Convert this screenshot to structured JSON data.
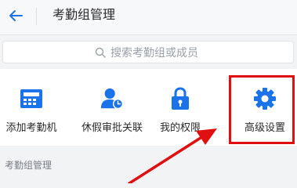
{
  "header": {
    "title": "考勤组管理"
  },
  "search": {
    "placeholder": "搜索考勤组或成员"
  },
  "tools": [
    {
      "label": "添加考勤机",
      "icon": "attendance-machine-icon"
    },
    {
      "label": "休假审批关联",
      "icon": "user-clock-icon"
    },
    {
      "label": "我的权限",
      "icon": "lock-icon"
    },
    {
      "label": "高级设置",
      "icon": "gear-icon"
    }
  ],
  "section": {
    "label": "考勤组管理"
  },
  "colors": {
    "accent": "#1a73e8",
    "highlight": "#e01010",
    "background": "#f2f3f5"
  }
}
